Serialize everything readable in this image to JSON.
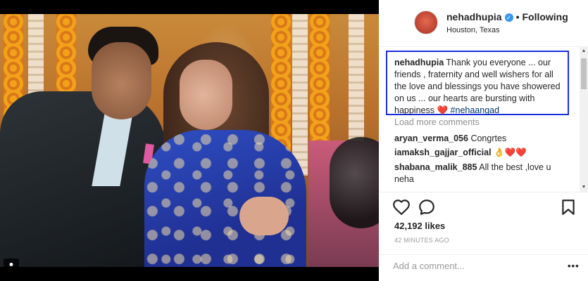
{
  "post": {
    "username": "nehadhupia",
    "verified_mark": "✓",
    "separator": "•",
    "follow_status": "Following",
    "location": "Houston, Texas"
  },
  "caption": {
    "username": "nehadhupia",
    "text": "Thank you everyone ... our friends , fraternity and well wishers for all the love and blessings you have showered on us ... our hearts are bursting with happiness",
    "emoji": "❤️",
    "hashtag": "#nehaangad"
  },
  "load_more": "Load more comments",
  "comments": [
    {
      "username": "aryan_verma_056",
      "text": "Congrtes"
    },
    {
      "username": "iamaksh_gajjar_official",
      "text": "👌❤️❤️"
    },
    {
      "username": "shabana_malik_885",
      "text": "All the best ,love u neha"
    }
  ],
  "likes": "42,192 likes",
  "timestamp": "42 minutes ago",
  "add_comment": {
    "placeholder": "Add a comment..."
  },
  "more_label": "•••",
  "icons": {
    "like": "heart-outline-icon",
    "comment": "comment-bubble-icon",
    "save": "bookmark-icon",
    "user_tag": "person-icon"
  },
  "colors": {
    "highlight_box": "#1a2ee0",
    "verified": "#3897f0",
    "hashtag": "#003569"
  }
}
